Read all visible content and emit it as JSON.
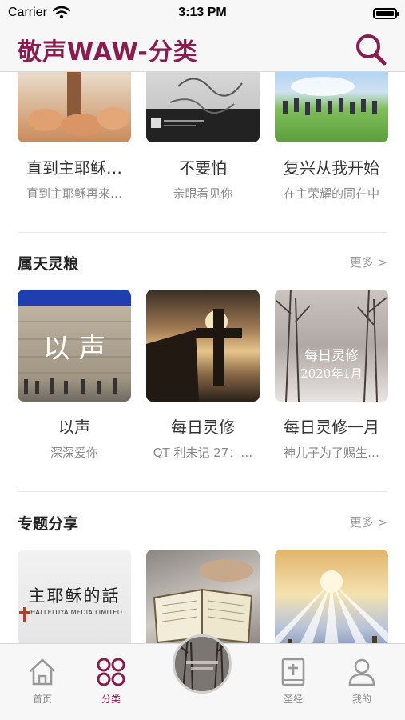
{
  "status": {
    "carrier": "Carrier",
    "time": "3:13 PM"
  },
  "header": {
    "title": "敬声WAW-分类"
  },
  "top_row": [
    {
      "title": "直到主耶稣…",
      "subtitle": "直到主耶稣再来…"
    },
    {
      "title": "不要怕",
      "subtitle": "亲眼看见你"
    },
    {
      "title": "复兴从我开始",
      "subtitle": "在主荣耀的同在中"
    }
  ],
  "sections": [
    {
      "title": "属天灵粮",
      "more": "更多 >",
      "items": [
        {
          "title": "以声",
          "subtitle": "深深爱你",
          "image_text": "以 声"
        },
        {
          "title": "每日灵修",
          "subtitle": "QT 利未记 27：…"
        },
        {
          "title": "每日灵修一月",
          "subtitle": "神儿子为了赐生…",
          "image_text": "每日灵修",
          "image_text2": "2020年1月"
        }
      ]
    },
    {
      "title": "专题分享",
      "more": "更多 >",
      "items": [
        {
          "image_text": "主耶稣的話",
          "image_caption": "HALLELUYA MEDIA LIMITED"
        },
        {},
        {}
      ]
    }
  ],
  "tabs": [
    {
      "label": "首页",
      "icon": "home-icon"
    },
    {
      "label": "分类",
      "icon": "category-icon",
      "active": true
    },
    {
      "label": "",
      "icon": "player-disc"
    },
    {
      "label": "圣经",
      "icon": "bible-icon"
    },
    {
      "label": "我的",
      "icon": "profile-icon"
    }
  ],
  "colors": {
    "accent": "#8b1d4e",
    "bar_bg": "#f7f7f7",
    "muted": "#8a8a8a"
  }
}
